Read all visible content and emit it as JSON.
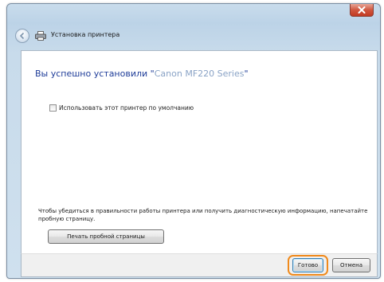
{
  "window": {
    "title": "Установка принтера",
    "icons": {
      "close": "close-icon",
      "back": "back-arrow-icon",
      "printer": "printer-icon"
    },
    "colors": {
      "accent": "#1f3d99",
      "highlight": "#f08a1c",
      "close": "#c23a22"
    }
  },
  "main": {
    "heading_prefix": "Вы успешно установили \"",
    "printer_name": "Canon MF220 Series",
    "heading_suffix": "\"",
    "default_checkbox_label": "Использовать этот принтер по умолчанию",
    "default_checkbox_checked": false,
    "info_text": "Чтобы убедиться в правильности работы принтера или получить диагностическую информацию, напечатайте пробную страницу.",
    "test_page_button": "Печать пробной страницы"
  },
  "footer": {
    "finish_button": "Готово",
    "cancel_button": "Отмена"
  }
}
